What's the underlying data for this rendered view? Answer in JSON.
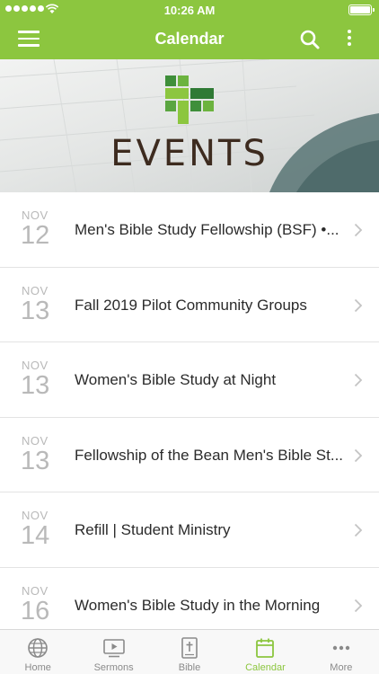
{
  "status_bar": {
    "time": "10:26 AM"
  },
  "nav": {
    "title": "Calendar"
  },
  "banner": {
    "heading": "EVENTS"
  },
  "events": [
    {
      "month": "NOV",
      "day": "12",
      "title": "Men's Bible Study Fellowship (BSF) •..."
    },
    {
      "month": "NOV",
      "day": "13",
      "title": "Fall 2019 Pilot Community Groups"
    },
    {
      "month": "NOV",
      "day": "13",
      "title": "Women's Bible Study at Night"
    },
    {
      "month": "NOV",
      "day": "13",
      "title": "Fellowship of the Bean Men's Bible St..."
    },
    {
      "month": "NOV",
      "day": "14",
      "title": "Refill | Student Ministry"
    },
    {
      "month": "NOV",
      "day": "16",
      "title": "Women's Bible Study in the Morning"
    }
  ],
  "tabs": [
    {
      "label": "Home",
      "icon": "globe-icon"
    },
    {
      "label": "Sermons",
      "icon": "play-screen-icon"
    },
    {
      "label": "Bible",
      "icon": "bible-cross-icon"
    },
    {
      "label": "Calendar",
      "icon": "calendar-icon",
      "active": true
    },
    {
      "label": "More",
      "icon": "ellipsis-icon"
    }
  ],
  "colors": {
    "brand_green": "#8cc63f",
    "events_text": "#3d2b1f",
    "date_gray": "#b9b9b9"
  }
}
